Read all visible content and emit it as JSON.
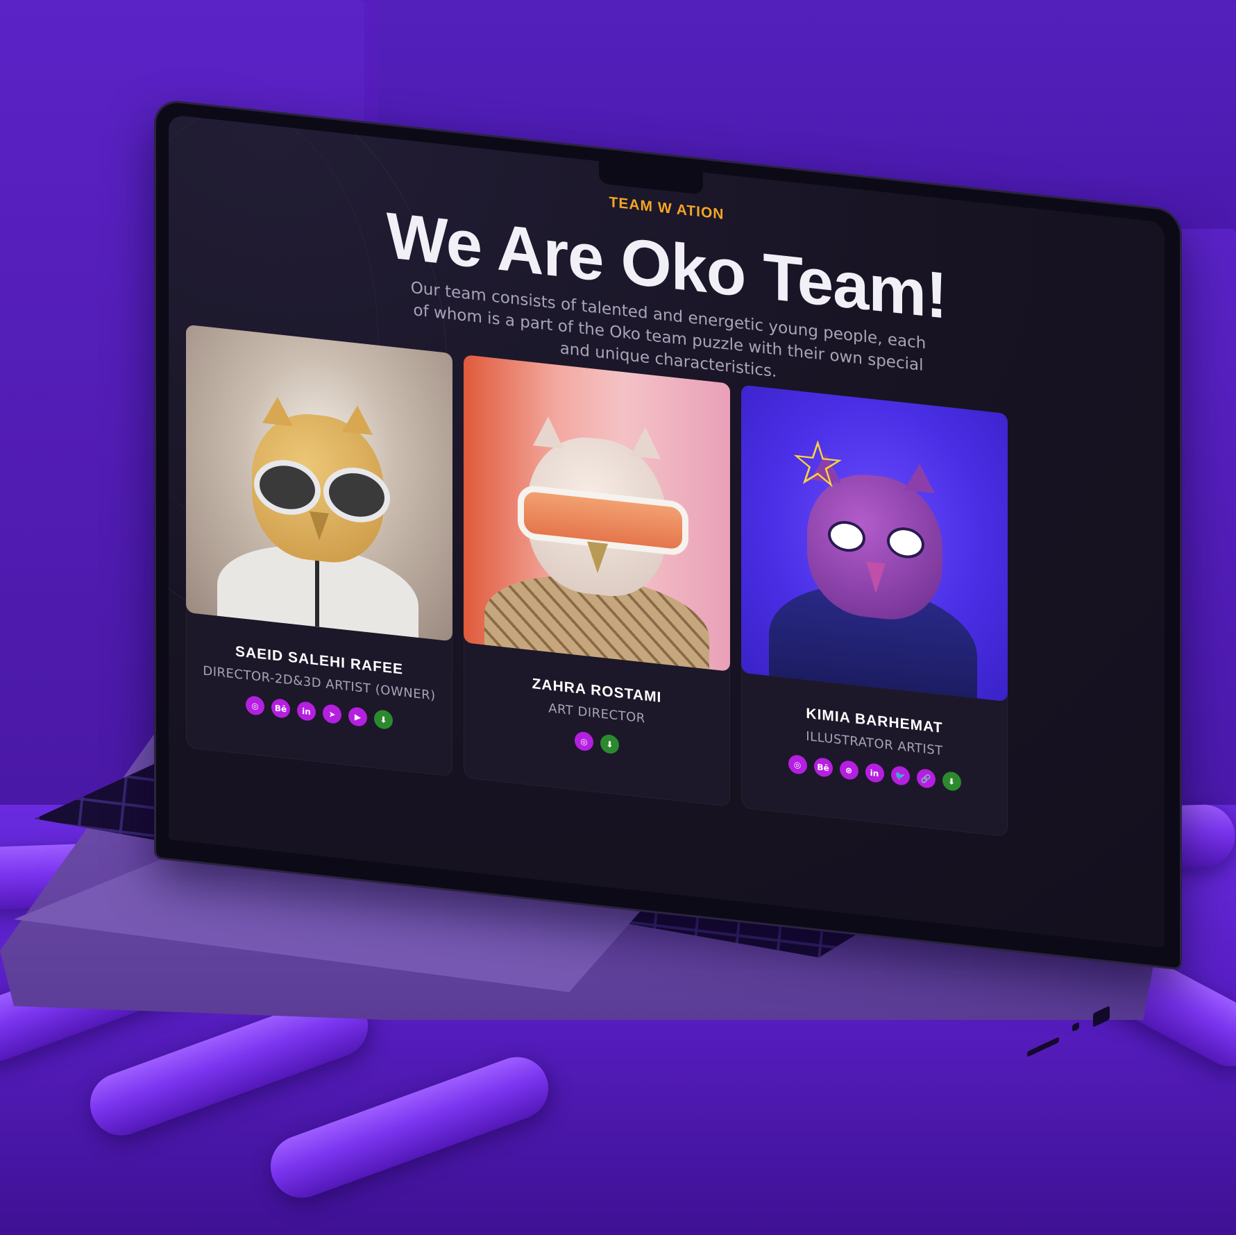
{
  "page": {
    "eyebrow": "TEAM W          ATION",
    "title": "We Are Oko Team!",
    "subtitle": "Our team consists of talented and energetic young people, each of whom is a part of the Oko team puzzle with their own special and unique characteristics."
  },
  "team": [
    {
      "name": "SAEID SALEHI RAFEE",
      "role": "DIRECTOR-2D&3D ARTIST (OWNER)",
      "icons": [
        "instagram-icon",
        "behance-icon",
        "linkedin-icon",
        "telegram-icon",
        "youtube-icon",
        "download-icon"
      ],
      "icon_glyphs": [
        "◎",
        "Bē",
        "in",
        "➤",
        "▶",
        "⬇"
      ]
    },
    {
      "name": "ZAHRA ROSTAMI",
      "role": "ART DIRECTOR",
      "icons": [
        "instagram-icon",
        "download-icon"
      ],
      "icon_glyphs": [
        "◎",
        "⬇"
      ]
    },
    {
      "name": "KIMIA BARHEMAT",
      "role": "ILLUSTRATOR ARTIST",
      "icons": [
        "instagram-icon",
        "behance-icon",
        "dribbble-icon",
        "linkedin-icon",
        "twitter-icon",
        "link-icon",
        "download-icon"
      ],
      "icon_glyphs": [
        "◎",
        "Bē",
        "⊛",
        "in",
        "🐦",
        "🔗",
        "⬇"
      ]
    }
  ],
  "colors": {
    "accent": "#f5a623",
    "icon": "#b51fe0",
    "download": "#2c8a2e",
    "background": "#5a1fc4"
  }
}
